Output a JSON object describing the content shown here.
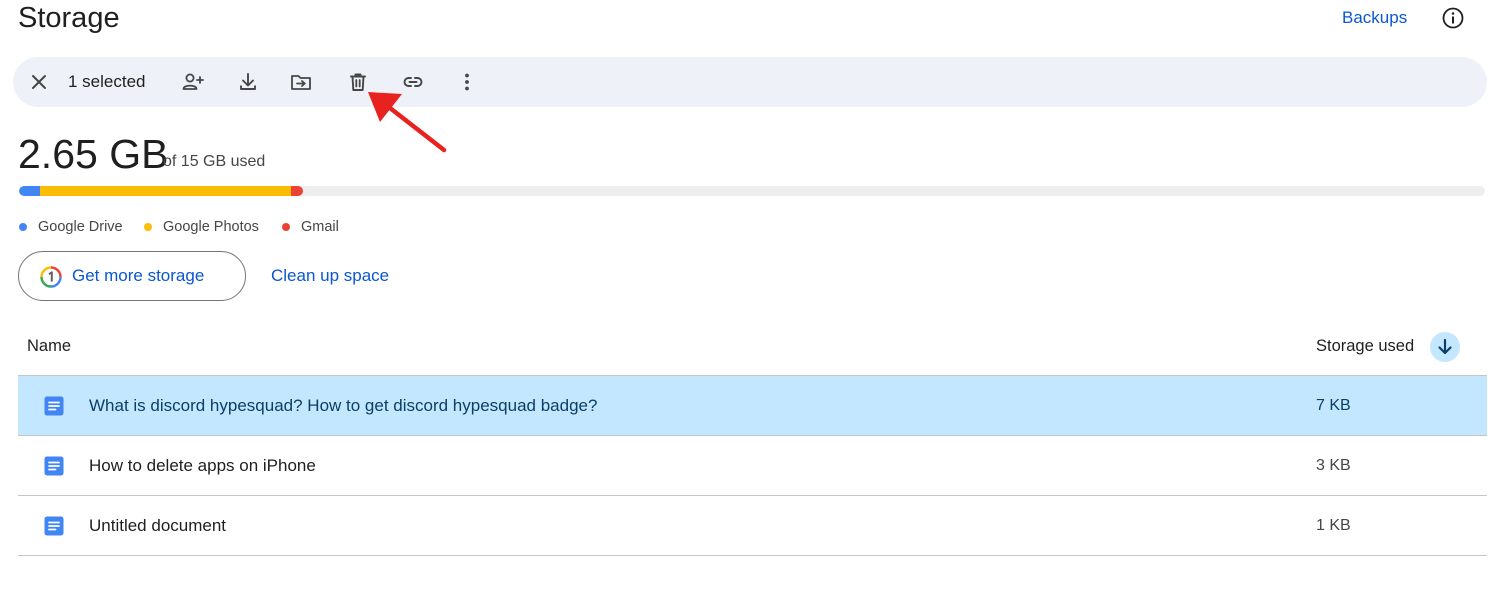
{
  "header": {
    "title": "Storage",
    "backups_label": "Backups",
    "info_icon": "info-icon"
  },
  "toolbar": {
    "selection_count": "1 selected",
    "icons": [
      "close-icon",
      "share-person-add-icon",
      "download-icon",
      "move-to-folder-icon",
      "trash-icon",
      "link-icon",
      "more-vert-icon"
    ]
  },
  "usage": {
    "amount": "2.65 GB",
    "total": "of 15 GB used",
    "segments": [
      {
        "name": "Google Drive",
        "fraction": 0.014,
        "color": "#4285f4"
      },
      {
        "name": "Google Photos",
        "fraction": 0.171,
        "color": "#fbbc04"
      },
      {
        "name": "Gmail",
        "fraction": 0.008,
        "color": "#ea4335"
      }
    ]
  },
  "legend": {
    "items": [
      {
        "label": "Google Drive",
        "color": "#4285f4"
      },
      {
        "label": "Google Photos",
        "color": "#fbbc04"
      },
      {
        "label": "Gmail",
        "color": "#ea4335"
      }
    ]
  },
  "actions": {
    "get_more_storage": "Get more storage",
    "clean_up_space": "Clean up space"
  },
  "table": {
    "col_name": "Name",
    "col_storage": "Storage used",
    "sort_icon": "arrow-down-icon",
    "rows": [
      {
        "name": "What is discord hypesquad? How to get discord hypesquad badge?",
        "size": "7 KB",
        "selected": true,
        "icon": "google-docs-icon"
      },
      {
        "name": "How to delete apps on iPhone",
        "size": "3 KB",
        "selected": false,
        "icon": "google-docs-icon"
      },
      {
        "name": "Untitled document",
        "size": "1 KB",
        "selected": false,
        "icon": "google-docs-icon"
      }
    ]
  },
  "colors": {
    "accent": "#0b57d0",
    "selected_row": "#c2e7ff",
    "toolbar_bg": "#eef2f8",
    "annotation_arrow": "#e8231f"
  }
}
